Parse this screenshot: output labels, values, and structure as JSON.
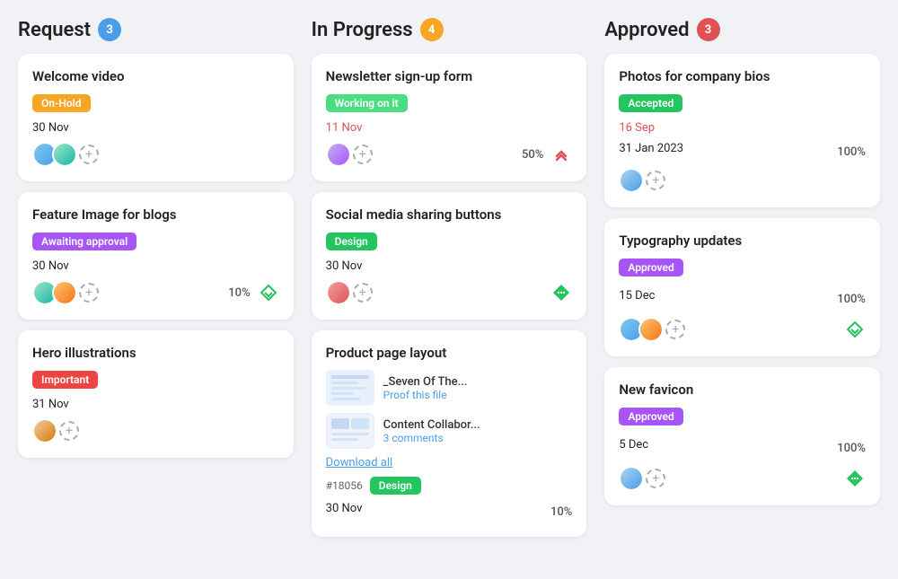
{
  "columns": [
    {
      "id": "request",
      "title": "Request",
      "badge": "3",
      "badge_color": "badge-blue",
      "cards": [
        {
          "id": "card-welcome-video",
          "title": "Welcome video",
          "tag": "On-Hold",
          "tag_class": "tag-onhold",
          "date": "30 Nov",
          "date_red": false,
          "avatars": [
            "face",
            "face-2"
          ],
          "show_add": true,
          "percent": "",
          "icon": ""
        },
        {
          "id": "card-feature-image",
          "title": "Feature Image for blogs",
          "tag": "Awaiting approval",
          "tag_class": "tag-awaiting",
          "date": "30 Nov",
          "date_red": false,
          "avatars": [
            "face-2",
            "face-3"
          ],
          "show_add": true,
          "percent": "10%",
          "icon": "down-diamond"
        },
        {
          "id": "card-hero",
          "title": "Hero illustrations",
          "tag": "Important",
          "tag_class": "tag-important",
          "date": "31 Nov",
          "date_red": false,
          "avatars": [
            "face-7"
          ],
          "show_add": true,
          "percent": "",
          "icon": ""
        }
      ]
    },
    {
      "id": "in-progress",
      "title": "In Progress",
      "badge": "4",
      "badge_color": "badge-yellow",
      "cards": [
        {
          "id": "card-newsletter",
          "title": "Newsletter sign-up form",
          "tag": "Working on it",
          "tag_class": "tag-working",
          "date": "11 Nov",
          "date_red": true,
          "avatars": [
            "face-4"
          ],
          "show_add": true,
          "percent": "50%",
          "icon": "up-arrows"
        },
        {
          "id": "card-social-media",
          "title": "Social media sharing buttons",
          "tag": "Design",
          "tag_class": "tag-design",
          "date": "30 Nov",
          "date_red": false,
          "avatars": [
            "face-5"
          ],
          "show_add": true,
          "percent": "",
          "icon": "dots-diamond"
        },
        {
          "id": "card-product-page",
          "title": "Product page layout",
          "tag": "",
          "tag_class": "",
          "date": "30 Nov",
          "date_red": false,
          "avatars": [],
          "show_add": false,
          "percent": "10%",
          "icon": "",
          "files": [
            {
              "name": "_Seven Of The...",
              "action": "Proof this file",
              "action_type": "proof"
            },
            {
              "name": "Content Collabor...",
              "action": "3 comments",
              "action_type": "comments"
            }
          ],
          "download": "Download all",
          "meta_id": "#18056",
          "meta_tag": "Design",
          "meta_tag_class": "tag-design"
        }
      ]
    },
    {
      "id": "approved",
      "title": "Approved",
      "badge": "3",
      "badge_color": "badge-red",
      "cards": [
        {
          "id": "card-photos",
          "title": "Photos for company bios",
          "tag": "Accepted",
          "tag_class": "tag-accepted",
          "date": "16 Sep",
          "date_red": true,
          "date2": "31 Jan 2023",
          "avatars": [
            "face-6"
          ],
          "show_add": true,
          "percent": "100%",
          "icon": ""
        },
        {
          "id": "card-typography",
          "title": "Typography updates",
          "tag": "Approved",
          "tag_class": "tag-approved",
          "date": "15 Dec",
          "date_red": false,
          "avatars": [
            "face",
            "face-3"
          ],
          "show_add": true,
          "percent": "100%",
          "icon": "down-diamond"
        },
        {
          "id": "card-favicon",
          "title": "New favicon",
          "tag": "Approved",
          "tag_class": "tag-approved",
          "date": "5 Dec",
          "date_red": false,
          "avatars": [
            "face-6"
          ],
          "show_add": true,
          "percent": "100%",
          "icon": "dots-diamond"
        }
      ]
    }
  ],
  "labels": {
    "add": "+",
    "download_all": "Download all"
  }
}
